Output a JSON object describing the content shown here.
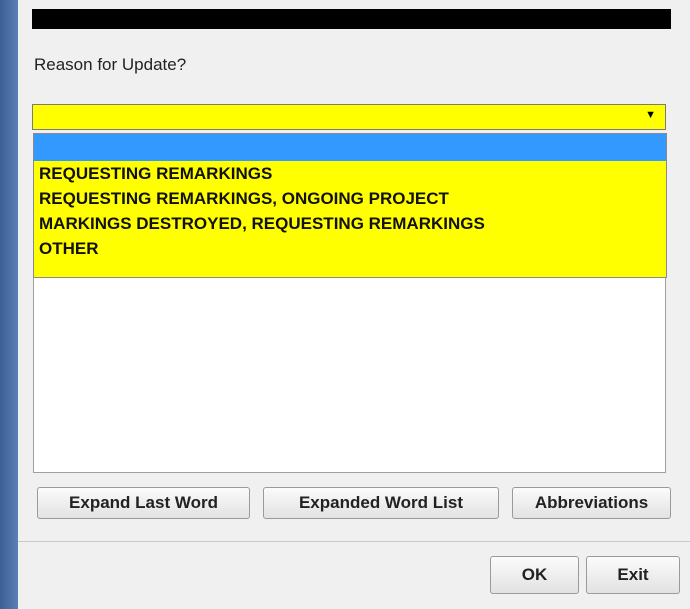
{
  "dialog": {
    "prompt": "Reason for Update?",
    "reason_select": {
      "selected_value": "",
      "options": [
        "",
        "REQUESTING REMARKINGS",
        "REQUESTING REMARKINGS, ONGOING PROJECT",
        "MARKINGS DESTROYED, REQUESTING REMARKINGS",
        "OTHER"
      ],
      "highlight_color": "#ffff00",
      "selected_option_color": "#3399ff"
    },
    "remarks_text": "",
    "word_tools": {
      "expand_last_word": "Expand Last Word",
      "expanded_word_list": "Expanded Word List",
      "abbreviations": "Abbreviations"
    },
    "actions": {
      "ok": "OK",
      "exit": "Exit"
    }
  }
}
